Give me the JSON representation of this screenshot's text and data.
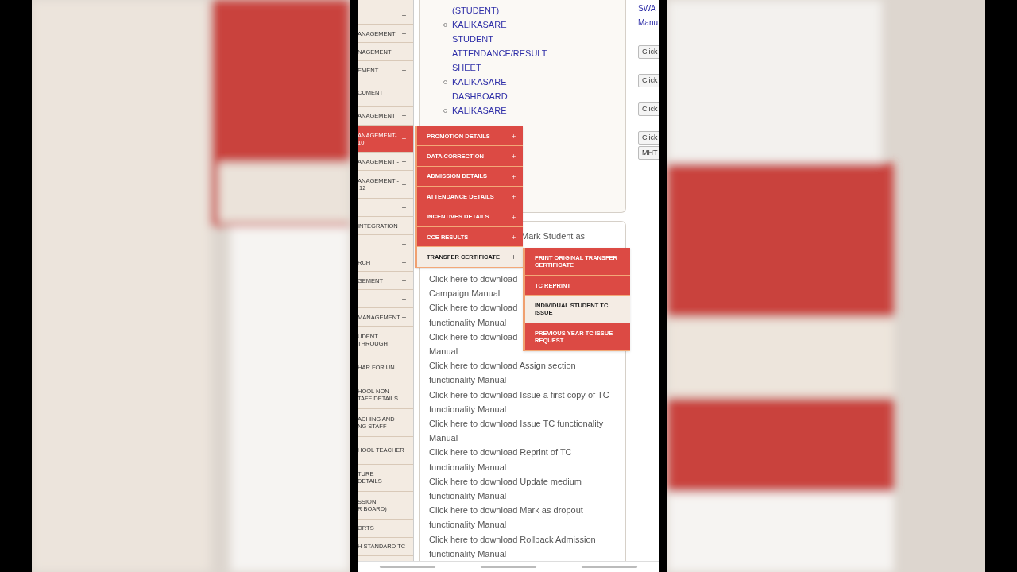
{
  "sidebar": {
    "items": [
      {
        "submenu": true,
        "selected": false
      },
      {
        "lines": [
          "ANAGEMENT"
        ],
        "submenu": true,
        "selected": false
      },
      {
        "lines": [
          "NAGEMENT"
        ],
        "submenu": true,
        "selected": false
      },
      {
        "lines": [
          "EMENT"
        ],
        "submenu": true,
        "selected": false
      },
      {
        "lines": [
          "CUMENT"
        ],
        "submenu": false,
        "selected": false,
        "tall": true
      },
      {
        "lines": [
          "ANAGEMENT"
        ],
        "submenu": true,
        "selected": false
      },
      {
        "lines": [
          "ANAGEMENT-",
          "10"
        ],
        "submenu": true,
        "selected": true
      },
      {
        "lines": [
          "ANAGEMENT -"
        ],
        "submenu": true,
        "selected": false
      },
      {
        "lines": [
          "ANAGEMENT -",
          " 12"
        ],
        "submenu": true,
        "selected": false
      },
      {
        "submenu": true,
        "selected": false
      },
      {
        "lines": [
          "INTEGRATION"
        ],
        "submenu": true,
        "selected": false
      },
      {
        "submenu": true,
        "selected": false
      },
      {
        "lines": [
          "RCH"
        ],
        "submenu": true,
        "selected": false
      },
      {
        "lines": [
          "GEMENT"
        ],
        "submenu": true,
        "selected": false
      },
      {
        "submenu": true,
        "selected": false
      },
      {
        "lines": [
          "MANAGEMENT"
        ],
        "submenu": true,
        "selected": false
      },
      {
        "lines": [
          "UDENT",
          "THROUGH"
        ],
        "submenu": false,
        "selected": false
      },
      {
        "lines": [
          "HAR FOR UN"
        ],
        "submenu": false,
        "selected": false,
        "tall": true
      },
      {
        "lines": [
          "HOOL NON",
          "TAFF DETAILS"
        ],
        "submenu": false,
        "selected": false
      },
      {
        "lines": [
          "ACHING AND",
          "NG STAFF"
        ],
        "submenu": false,
        "selected": false
      },
      {
        "lines": [
          "HOOL TEACHER"
        ],
        "submenu": false,
        "selected": false,
        "tall": true
      },
      {
        "lines": [
          "TURE",
          "DETAILS"
        ],
        "submenu": false,
        "selected": false
      },
      {
        "lines": [
          "SSION",
          "R BOARD)"
        ],
        "submenu": false,
        "selected": false
      },
      {
        "lines": [
          "ORTS"
        ],
        "submenu": true,
        "selected": false
      },
      {
        "lines": [
          "H STANDARD TC"
        ],
        "submenu": false,
        "selected": false
      }
    ]
  },
  "top_card": {
    "items": [
      {
        "text": "(STUDENT)",
        "bullet": false
      },
      {
        "text": "KALIKASARE STUDENT ATTENDANCE/RESULT SHEET",
        "bullet": true
      },
      {
        "text": "KALIKASARE DASHBOARD",
        "bullet": true
      },
      {
        "text": "KALIKASARE",
        "bullet": true
      }
    ]
  },
  "mark_card": {
    "text": "Mark Student as"
  },
  "manuals": [
    {
      "lines": [
        "Click here to download",
        "Campaign Manual"
      ]
    },
    {
      "lines": [
        "Click here to download",
        "functionality Manual"
      ]
    },
    {
      "lines": [
        "Click here to download",
        "Manual"
      ]
    },
    {
      "lines": [
        "Click here to download Assign section",
        "functionality Manual"
      ]
    },
    {
      "lines": [
        "Click here to download Issue a first copy of TC",
        "functionality Manual"
      ]
    },
    {
      "lines": [
        "Click here to download Issue TC functionality",
        "Manual"
      ]
    },
    {
      "lines": [
        "Click here to download Reprint of TC",
        "functionality Manual"
      ]
    },
    {
      "lines": [
        "Click here to download Update medium",
        "functionality Manual"
      ]
    },
    {
      "lines": [
        "Click here to download Mark as dropout",
        "functionality Manual"
      ]
    },
    {
      "lines": [
        "Click here to download Rollback Admission",
        "functionality Manual"
      ]
    }
  ],
  "right_column": {
    "links": [
      "SWA",
      "Manu"
    ],
    "buttons": [
      "Click",
      "Click",
      "Click",
      "Click",
      "MHT"
    ]
  },
  "menu": [
    {
      "label": "PROMOTION DETAILS",
      "selected": false
    },
    {
      "label": "DATA CORRECTION",
      "selected": false
    },
    {
      "label": "ADMISSION DETAILS",
      "selected": false
    },
    {
      "label": "ATTENDANCE DETAILS",
      "selected": false
    },
    {
      "label": "INCENTIVES DETAILS",
      "selected": false
    },
    {
      "label": "CCE RESULTS",
      "selected": false
    },
    {
      "label": "TRANSFER CERTIFICATE",
      "selected": true
    }
  ],
  "submenu": [
    {
      "label": "PRINT ORIGINAL TRANSFER CERTIFICATE",
      "selected": false
    },
    {
      "label": "TC REPRINT",
      "selected": false
    },
    {
      "label": "INDIVIDUAL STUDENT TC ISSUE",
      "selected": true
    },
    {
      "label": "PREVIOUS YEAR TC ISSUE REQUEST",
      "selected": false
    }
  ]
}
